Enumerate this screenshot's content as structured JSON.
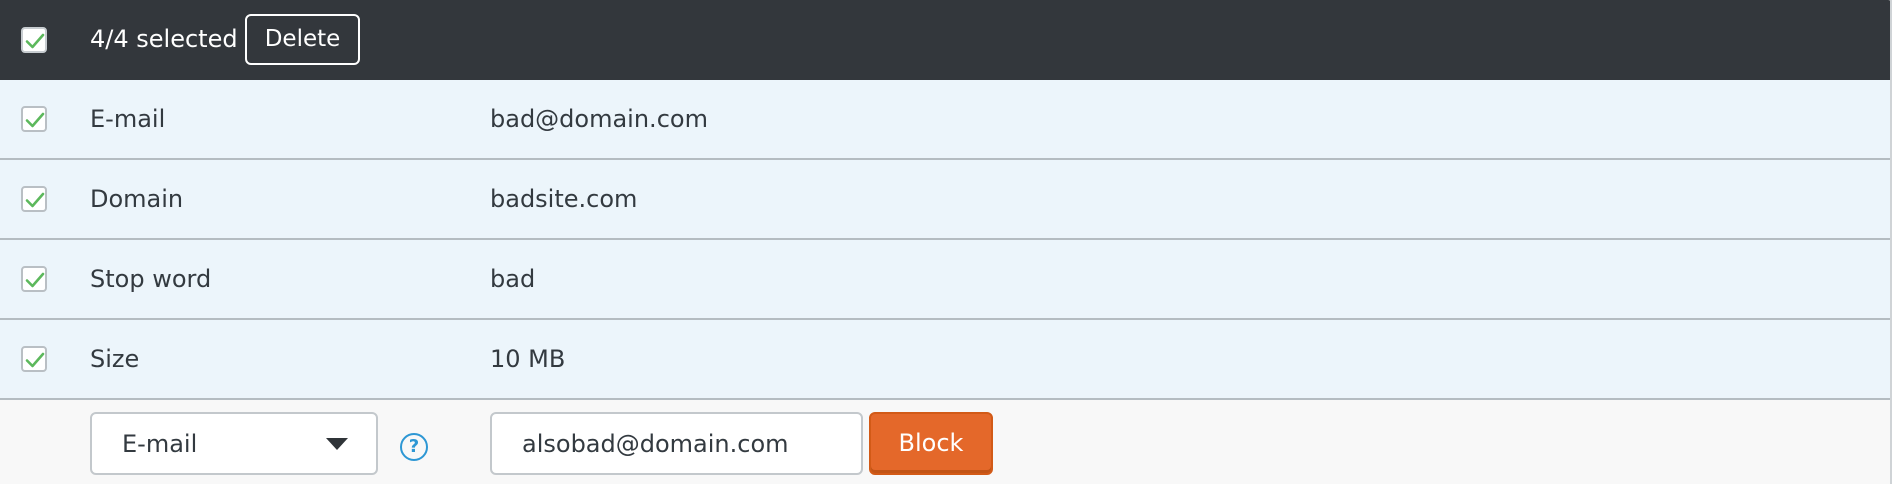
{
  "header": {
    "selected_text": "4/4 selected",
    "delete_label": "Delete",
    "all_selected": true
  },
  "rows": [
    {
      "type": "E-mail",
      "value": "bad@domain.com",
      "checked": true
    },
    {
      "type": "Domain",
      "value": "badsite.com",
      "checked": true
    },
    {
      "type": "Stop word",
      "value": "bad",
      "checked": true
    },
    {
      "type": "Size",
      "value": "10 MB",
      "checked": true
    }
  ],
  "form": {
    "type_selected": "E-mail",
    "help_icon": "question-circle-icon",
    "value_input": "alsobad@domain.com",
    "block_label": "Block"
  },
  "colors": {
    "header_bg": "#33373c",
    "row_bg": "#ecf5fb",
    "check": "#5cb85c",
    "accent_orange": "#e4682a",
    "help_blue": "#2d97d4"
  }
}
